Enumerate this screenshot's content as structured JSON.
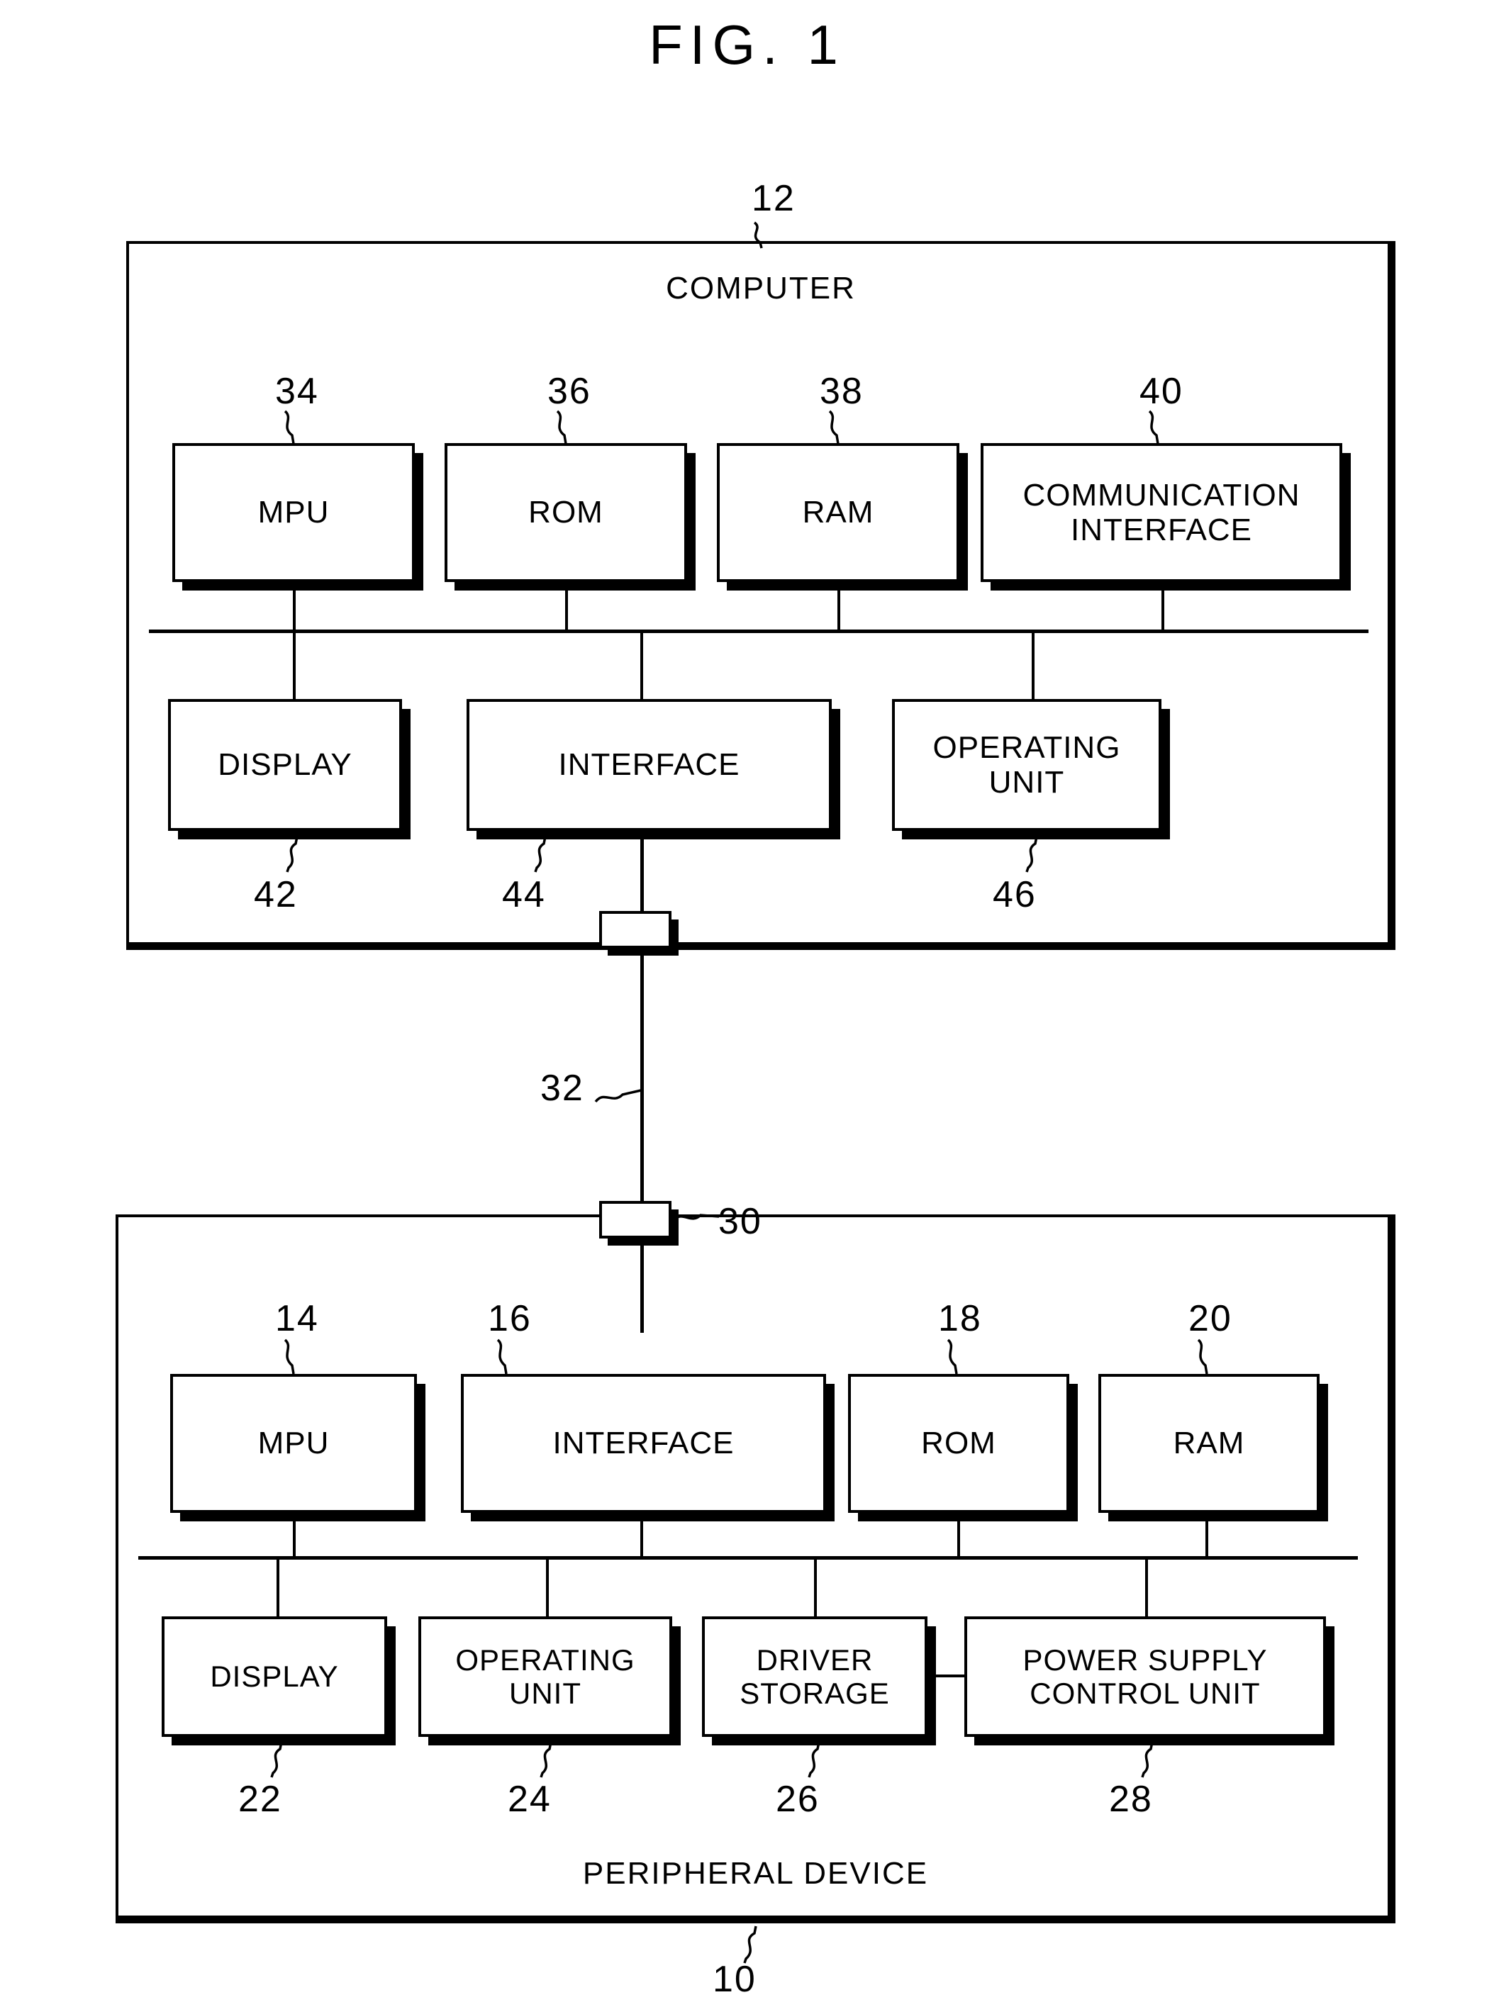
{
  "figure": {
    "title": "FIG. 1",
    "system_ref": "10"
  },
  "computer": {
    "caption": "COMPUTER",
    "ref": "12",
    "components": [
      {
        "label": "MPU",
        "ref": "34",
        "ref_position": "above"
      },
      {
        "label": "ROM",
        "ref": "36",
        "ref_position": "above"
      },
      {
        "label": "RAM",
        "ref": "38",
        "ref_position": "above"
      },
      {
        "label": "COMMUNICATION\nINTERFACE",
        "ref": "40",
        "ref_position": "above"
      },
      {
        "label": "DISPLAY",
        "ref": "42",
        "ref_position": "below"
      },
      {
        "label": "INTERFACE",
        "ref": "44",
        "ref_position": "below"
      },
      {
        "label": "OPERATING\nUNIT",
        "ref": "46",
        "ref_position": "below"
      }
    ]
  },
  "peripheral": {
    "caption": "PERIPHERAL DEVICE",
    "ref": "10",
    "components": [
      {
        "label": "MPU",
        "ref": "14",
        "ref_position": "above"
      },
      {
        "label": "INTERFACE",
        "ref": "16",
        "ref_position": "above"
      },
      {
        "label": "ROM",
        "ref": "18",
        "ref_position": "above"
      },
      {
        "label": "RAM",
        "ref": "20",
        "ref_position": "above"
      },
      {
        "label": "DISPLAY",
        "ref": "22",
        "ref_position": "below"
      },
      {
        "label": "OPERATING\nUNIT",
        "ref": "24",
        "ref_position": "below"
      },
      {
        "label": "DRIVER\nSTORAGE",
        "ref": "26",
        "ref_position": "below"
      },
      {
        "label": "POWER SUPPLY\nCONTROL UNIT",
        "ref": "28",
        "ref_position": "below"
      }
    ]
  },
  "connection": {
    "cable_ref": "32",
    "computer_port_ref": "",
    "peripheral_port_ref": "30"
  }
}
